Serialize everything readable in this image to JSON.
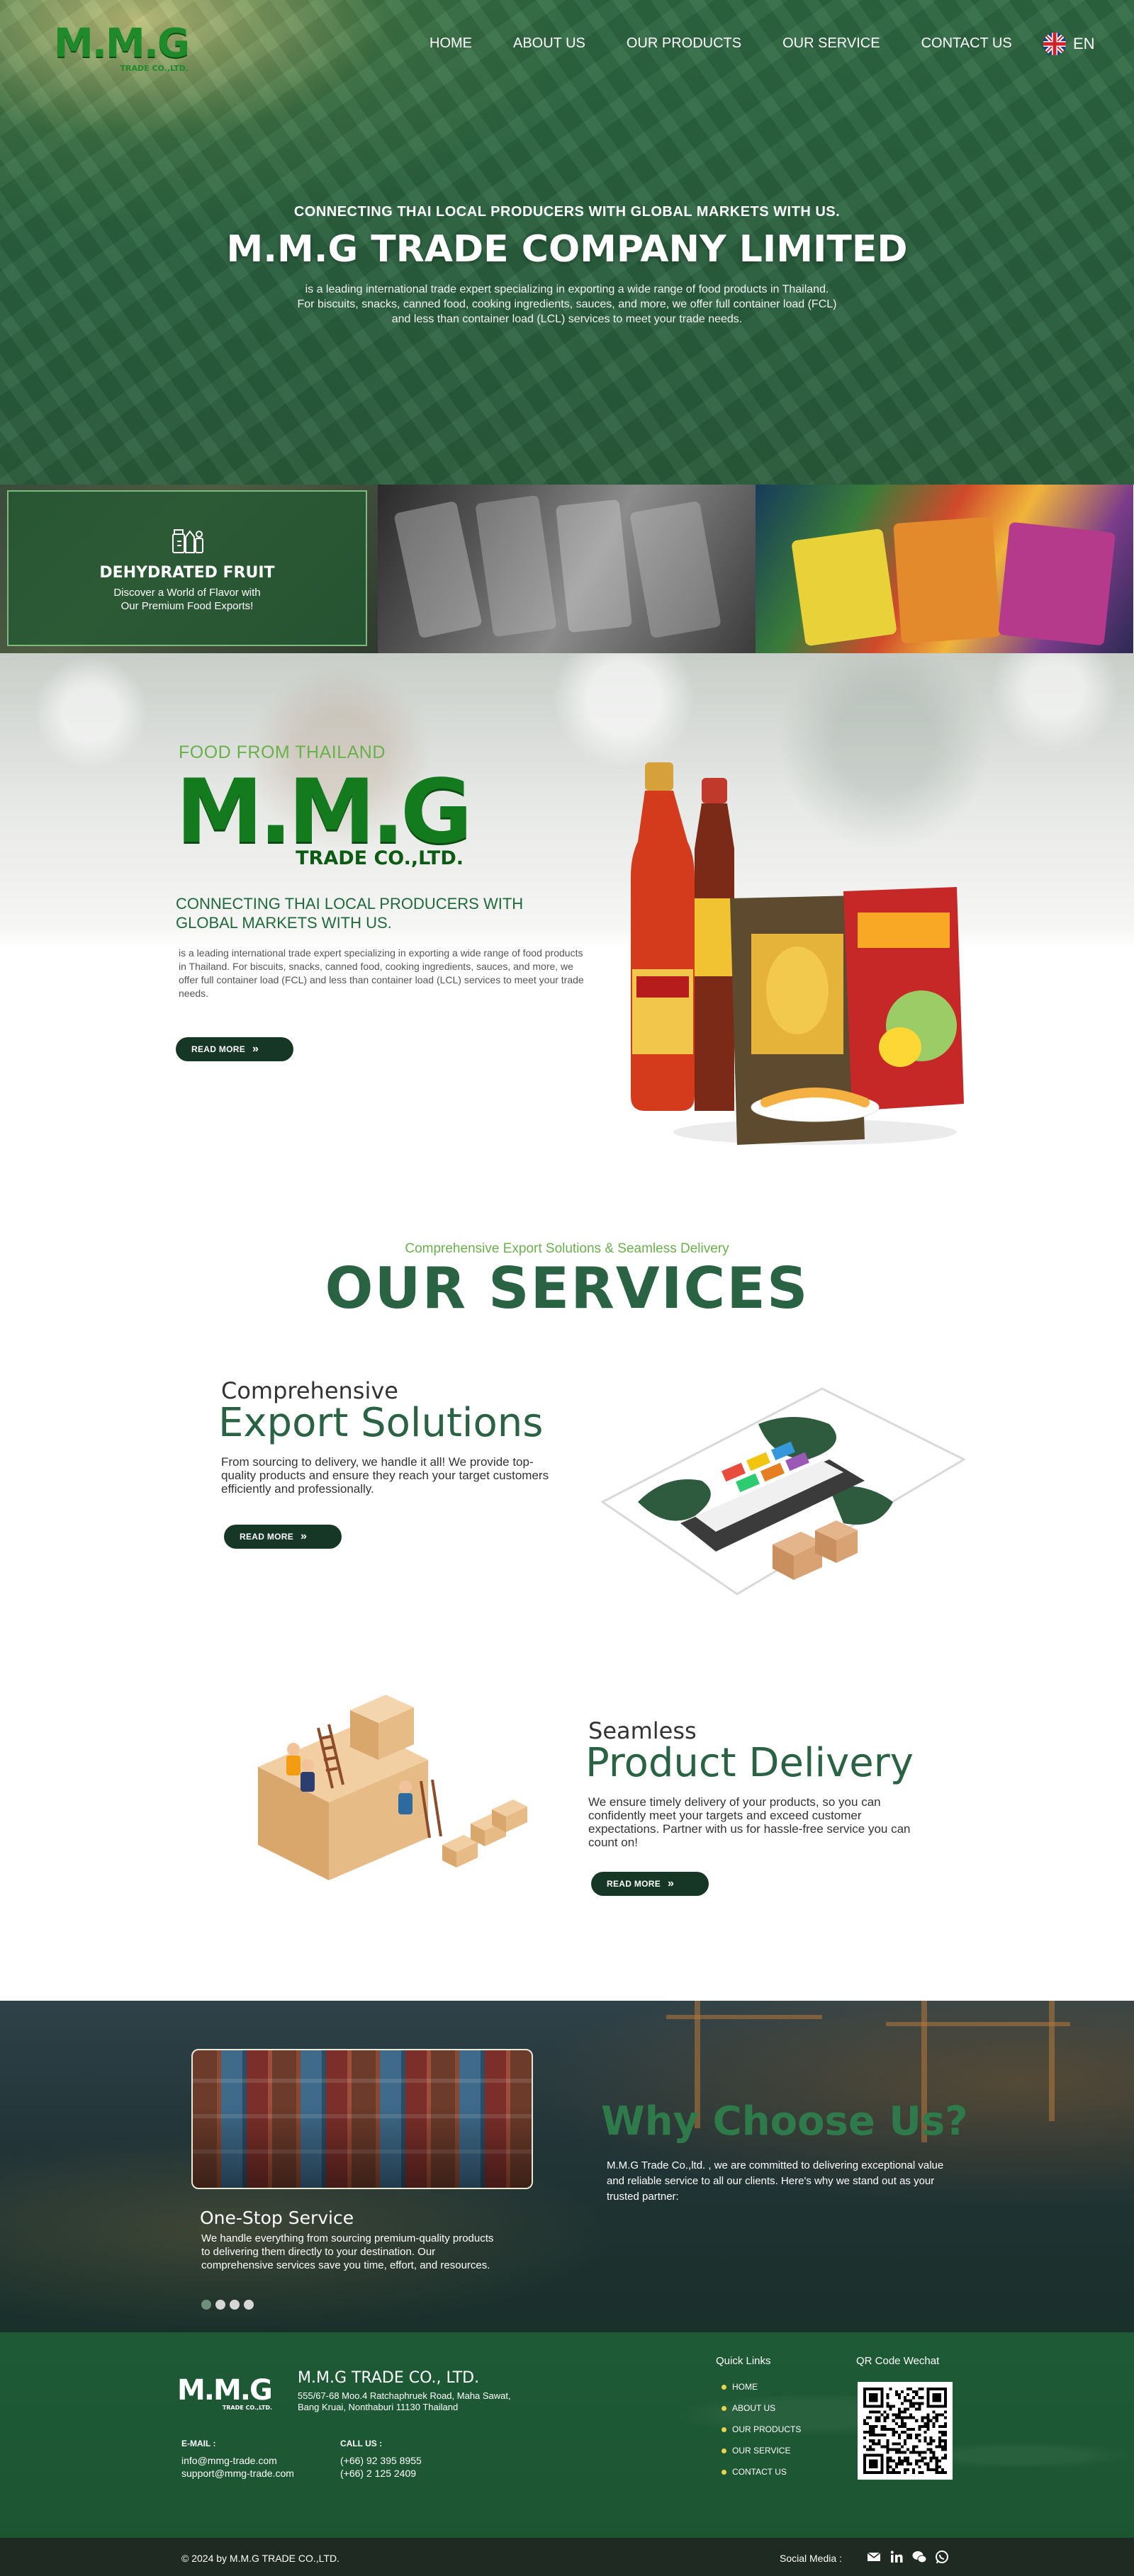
{
  "header": {
    "logo_text": "M.M.G",
    "logo_sub": "TRADE CO.,LTD.",
    "nav": [
      "HOME",
      "ABOUT US",
      "OUR PRODUCTS",
      "OUR SERVICE",
      "CONTACT US"
    ],
    "language": "EN"
  },
  "hero": {
    "kicker": "CONNECTING THAI LOCAL PRODUCERS WITH GLOBAL MARKETS WITH US.",
    "title": "M.M.G TRADE COMPANY LIMITED",
    "desc_lines": [
      "is a leading international trade expert specializing in exporting a wide range of food products in Thailand.",
      "For biscuits, snacks, canned food, cooking ingredients, sauces, and more, we offer full container load (FCL)",
      "and less than container load (LCL) services to meet your trade needs."
    ]
  },
  "strip": {
    "title": "DEHYDRATED FRUIT",
    "desc_lines": [
      "Discover a World of Flavor with",
      "Our Premium Food Exports!"
    ]
  },
  "about": {
    "kicker": "FOOD FROM THAILAND",
    "logo_text": "M.M.G",
    "logo_sub": "TRADE CO.,LTD.",
    "headline": "CONNECTING THAI LOCAL PRODUCERS WITH GLOBAL MARKETS WITH US.",
    "desc": "is a leading international trade expert specializing in exporting a wide range of food products in Thailand. For biscuits, snacks, canned food, cooking ingredients, sauces, and more, we offer full container load (FCL) and less than container load (LCL) services to meet your trade needs.",
    "button": "READ MORE"
  },
  "services": {
    "kicker": "Comprehensive Export Solutions & Seamless Delivery",
    "title": "OUR SERVICES",
    "items": [
      {
        "small": "Comprehensive",
        "big": "Export Solutions",
        "desc": "From sourcing to delivery, we handle it all! We provide top-quality products and ensure they reach your target customers efficiently and professionally.",
        "button": "READ MORE"
      },
      {
        "small": "Seamless",
        "big": "Product Delivery",
        "desc": "We ensure timely delivery of your products, so you can confidently meet your targets and exceed customer expectations. Partner with us for hassle-free service you can count on!",
        "button": "READ MORE"
      }
    ]
  },
  "why": {
    "title": "Why Choose Us?",
    "desc": "M.M.G Trade Co.,ltd. , we are committed to delivering exceptional value and reliable service to all our clients. Here's why we stand out as your trusted partner:",
    "item_title": "One-Stop Service",
    "item_desc": "We handle everything from sourcing premium-quality products to delivering them directly to your destination. Our comprehensive services save you time, effort, and resources.",
    "slides_total": 4,
    "slide_active": 1
  },
  "footer": {
    "logo_text": "M.M.G",
    "logo_sub": "TRADE CO.,LTD.",
    "company": "M.M.G TRADE CO., LTD.",
    "address_lines": [
      "555/67-68 Moo.4 Ratchaphruek Road, Maha Sawat,",
      "Bang Kruai, Nonthaburi  11130 Thailand"
    ],
    "email_label": "E-MAIL :",
    "emails": [
      "info@mmg-trade.com",
      "support@mmg-trade.com"
    ],
    "call_label": "CALL US :",
    "phones": [
      "(+66) 92 395 8955",
      "(+66) 2 125 2409"
    ],
    "quick_links_title": "Quick Links",
    "quick_links": [
      "HOME",
      "ABOUT US",
      "OUR PRODUCTS",
      "OUR SERVICE",
      "CONTACT US"
    ],
    "qr_title": "QR Code Wechat",
    "copyright": "© 2024 by M.M.G TRADE CO.,LTD.",
    "social_label": "Social Media :",
    "social_icons": [
      "mail-icon",
      "linkedin-icon",
      "wechat-icon",
      "whatsapp-icon"
    ]
  },
  "colors": {
    "brand_green": "#2a6344",
    "accent_light_green": "#6ab04c",
    "button_dark": "#163726",
    "logo_green": "#137b1e",
    "footer_bottom": "#1f2a22"
  }
}
